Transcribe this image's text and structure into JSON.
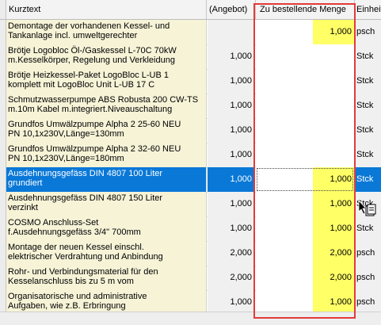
{
  "header": {
    "col_kurztext": "Kurztext",
    "col_angebot": "(Angebot)",
    "col_menge": "Zu bestellende Menge",
    "col_einheit": "Einheit"
  },
  "rows": [
    {
      "text": "Demontage der vorhandenen Kessel- und\nTankanlage incl. umweltgerechter",
      "angebot": "",
      "menge": "1,000",
      "einheit": "psch"
    },
    {
      "text": "Brötje Logobloc Öl-/Gaskessel L-70C 70kW\nm.Kesselkörper, Regelung und Verkleidung",
      "angebot": "1,000",
      "menge": "",
      "einheit": "Stck"
    },
    {
      "text": "Brötje Heizkessel-Paket LogoBloc L-UB 1\nkomplett mit LogoBloc Unit L-UB 17 C",
      "angebot": "1,000",
      "menge": "",
      "einheit": "Stck"
    },
    {
      "text": "Schmutzwasserpumpe ABS Robusta 200 CW-TS\nm.10m Kabel m.integriert.Niveauschaltung",
      "angebot": "1,000",
      "menge": "",
      "einheit": "Stck"
    },
    {
      "text": "Grundfos Umwälzpumpe Alpha 2 25-60 NEU\nPN 10,1x230V,Länge=130mm",
      "angebot": "1,000",
      "menge": "",
      "einheit": "Stck"
    },
    {
      "text": "Grundfos Umwälzpumpe Alpha 2 32-60 NEU\nPN 10,1x230V,Länge=180mm",
      "angebot": "1,000",
      "menge": "",
      "einheit": "Stck"
    },
    {
      "text": "Ausdehnungsgefäss DIN 4807 100 Liter\ngrundiert",
      "angebot": "1,000",
      "menge": "1,000",
      "einheit": "Stck",
      "active": true
    },
    {
      "text": "Ausdehnungsgefäss DIN 4807 150 Liter\nverzinkt",
      "angebot": "1,000",
      "menge": "1,000",
      "einheit": "Stck"
    },
    {
      "text": "COSMO Anschluss-Set\nf.Ausdehnungsgefäss 3/4\" 700mm",
      "angebot": "1,000",
      "menge": "1,000",
      "einheit": "Stck"
    },
    {
      "text": "Montage der neuen Kessel einschl.\nelektrischer Verdrahtung und Anbindung",
      "angebot": "2,000",
      "menge": "2,000",
      "einheit": "psch"
    },
    {
      "text": "Rohr- und Verbindungsmaterial für den\nKesselanschluss bis zu 5 m vom",
      "angebot": "2,000",
      "menge": "2,000",
      "einheit": "psch"
    },
    {
      "text": "Organisatorische und administrative\nAufgaben, wie z.B. Erbringung",
      "angebot": "1,000",
      "menge": "1,000",
      "einheit": "psch"
    }
  ],
  "colors": {
    "highlight_yellow": "#ffff66",
    "selection_blue": "#0a78d7",
    "annotation_red": "#e23b3b",
    "text_column_bg": "#f6f3d7"
  }
}
